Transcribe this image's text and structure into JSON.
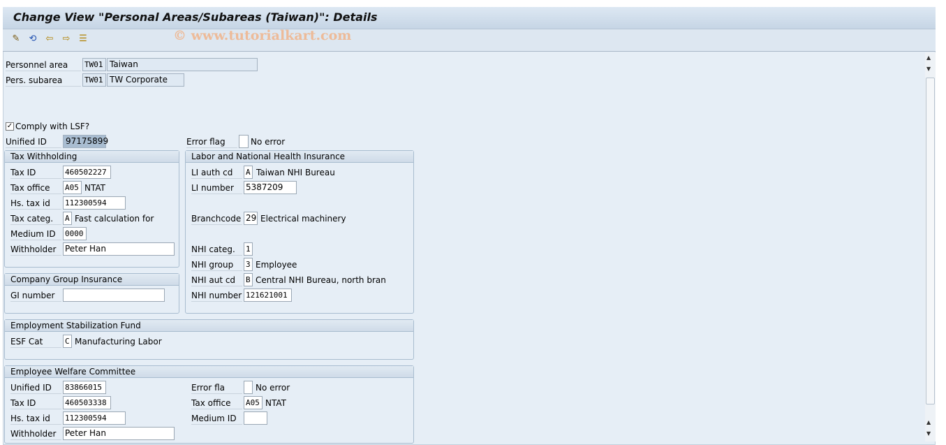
{
  "title": "Change View \"Personal Areas/Subareas (Taiwan)\": Details",
  "watermark": "© www.tutorialkart.com",
  "toolbar": [
    "edit-pencil-icon",
    "other-view-icon",
    "previous-entry-icon",
    "next-entry-icon",
    "select-entry-icon"
  ],
  "header": {
    "pa_label": "Personnel area",
    "pa_code": "TW01",
    "pa_text": "Taiwan",
    "psa_label": "Pers. subarea",
    "psa_code": "TW01",
    "psa_text": "TW Corporate"
  },
  "comply": {
    "label": "Comply with LSF?",
    "checked": true
  },
  "unified": {
    "label": "Unified ID",
    "value": "97175899",
    "err_label": "Error flag",
    "err_value": "",
    "err_text": "No error"
  },
  "tax": {
    "title": "Tax Withholding",
    "taxid_l": "Tax ID",
    "taxid": "460502227",
    "office_l": "Tax office",
    "office": "A05",
    "office_t": "NTAT",
    "hs_l": "Hs. tax id",
    "hs": "112300594",
    "categ_l": "Tax categ.",
    "categ": "A",
    "categ_t": "Fast calculation for",
    "medium_l": "Medium ID",
    "medium": "0000",
    "with_l": "Withholder",
    "with": "Peter Han"
  },
  "labor": {
    "title": "Labor and National Health Insurance",
    "li_auth_l": "LI auth cd",
    "li_auth": "A",
    "li_auth_t": "Taiwan NHI Bureau",
    "li_num_l": "LI number",
    "li_num": "5387209",
    "branch_l": "Branchcode",
    "branch": "29",
    "branch_t": "Electrical machinery",
    "nhi_categ_l": "NHI categ.",
    "nhi_categ": "1",
    "nhi_group_l": "NHI group",
    "nhi_group": "3",
    "nhi_group_t": "Employee",
    "nhi_aut_l": "NHI aut cd",
    "nhi_aut": "B",
    "nhi_aut_t": "Central NHI Bureau, north bran",
    "nhi_num_l": "NHI number",
    "nhi_num": "121621001"
  },
  "cgi": {
    "title": "Company Group Insurance",
    "gi_l": "GI number",
    "gi": ""
  },
  "esf": {
    "title": "Employment Stabilization Fund",
    "cat_l": "ESF Cat",
    "cat": "C",
    "cat_t": "Manufacturing Labor"
  },
  "ewc": {
    "title": "Employee Welfare Committee",
    "uid_l": "Unified ID",
    "uid": "83866015",
    "taxid_l": "Tax ID",
    "taxid": "460503338",
    "hs_l": "Hs. tax id",
    "hs": "112300594",
    "with_l": "Withholder",
    "with": "Peter Han",
    "err_l": "Error fla",
    "err": "",
    "err_t": "No error",
    "office_l": "Tax office",
    "office": "A05",
    "office_t": "NTAT",
    "medium_l": "Medium ID",
    "medium": ""
  }
}
